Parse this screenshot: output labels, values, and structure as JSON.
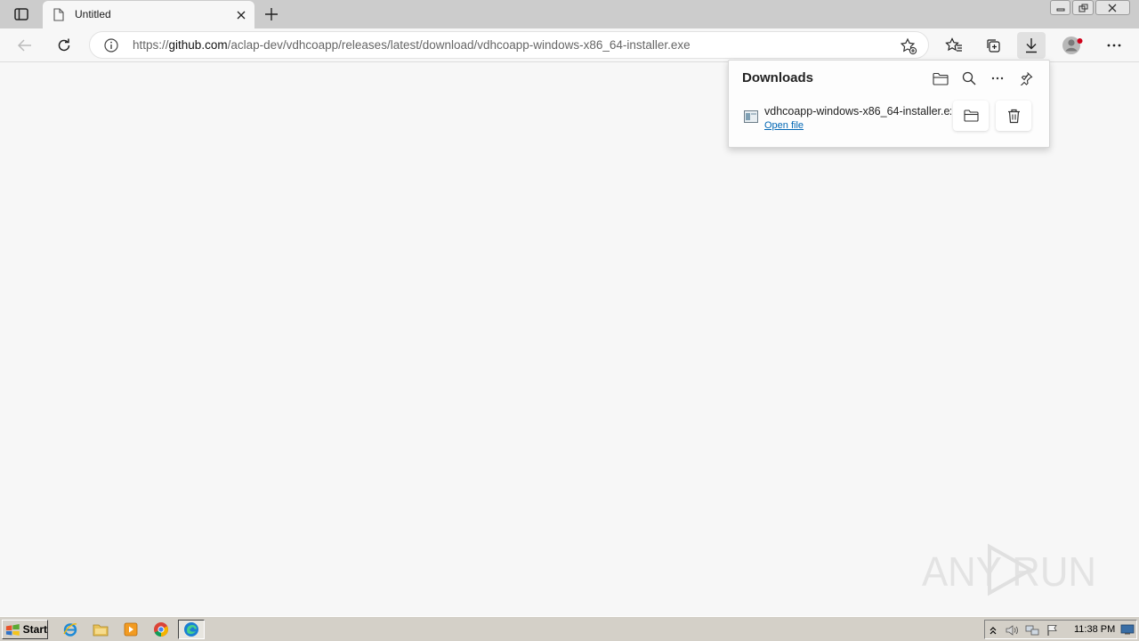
{
  "tab": {
    "title": "Untitled"
  },
  "address": {
    "protocol": "https://",
    "host": "github.com",
    "path": "/aclap-dev/vdhcoapp/releases/latest/download/vdhcoapp-windows-x86_64-installer.exe"
  },
  "downloads": {
    "title": "Downloads",
    "items": [
      {
        "filename": "vdhcoapp-windows-x86_64-installer.exe",
        "action": "Open file"
      }
    ]
  },
  "watermark": {
    "text": "ANY RUN"
  },
  "taskbar": {
    "start_label": "Start",
    "clock": "11:38 PM"
  },
  "icons": [
    "tab-actions-icon",
    "page-icon",
    "close-icon",
    "plus-icon",
    "back-icon",
    "refresh-icon",
    "info-icon",
    "add-favorite-icon",
    "favorites-icon",
    "collections-icon",
    "download-icon",
    "profile-icon",
    "more-icon",
    "folder-icon",
    "search-icon",
    "pin-icon",
    "trash-icon"
  ],
  "colors": {
    "accent_link": "#0066b4",
    "profile_badge": "#d0021b"
  }
}
